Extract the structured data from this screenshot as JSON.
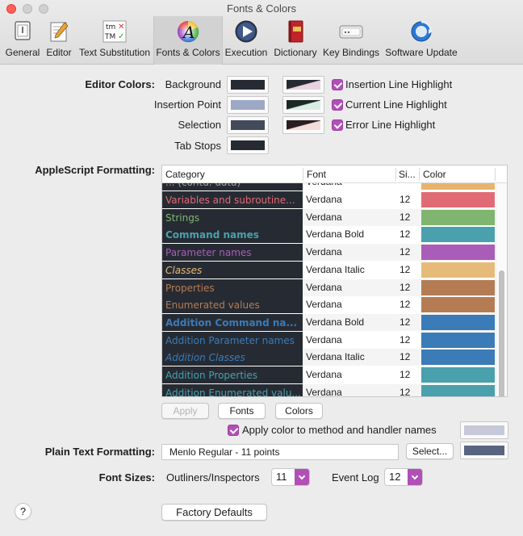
{
  "window": {
    "title": "Fonts & Colors"
  },
  "toolbar": [
    {
      "label": "General",
      "icon": "general-icon"
    },
    {
      "label": "Editor",
      "icon": "editor-icon"
    },
    {
      "label": "Text Substitution",
      "icon": "text-substitution-icon",
      "icon_text": "tm ✕\nTM ✓"
    },
    {
      "label": "Fonts & Colors",
      "icon": "fonts-colors-icon",
      "icon_text": "A"
    },
    {
      "label": "Execution",
      "icon": "execution-icon"
    },
    {
      "label": "Dictionary",
      "icon": "dictionary-icon"
    },
    {
      "label": "Key Bindings",
      "icon": "key-bindings-icon"
    },
    {
      "label": "Software Update",
      "icon": "software-update-icon"
    }
  ],
  "editor_colors": {
    "section_label": "Editor Colors:",
    "background_label": "Background",
    "insertion_point_label": "Insertion Point",
    "selection_label": "Selection",
    "tab_stops_label": "Tab Stops",
    "background_color": "#262b33",
    "insertion_point_color": "#9ca8c6",
    "selection_color": "#434b5a",
    "tab_stops_color": "#262b33",
    "highlights": [
      {
        "label": "Insertion Line Highlight",
        "checked": true,
        "colors": [
          "#262b33",
          "#e6d2e0"
        ]
      },
      {
        "label": "Current Line Highlight",
        "checked": true,
        "colors": [
          "#1c2a26",
          "#d8eee4"
        ]
      },
      {
        "label": "Error Line Highlight",
        "checked": true,
        "colors": [
          "#2a1e1e",
          "#f4dcd8"
        ]
      }
    ]
  },
  "applescript": {
    "section_label": "AppleScript Formatting:",
    "columns": [
      "Category",
      "Font",
      "Si...",
      "Color"
    ],
    "partial_top_row": {
      "category": "... (contd. data)",
      "font": "Verdana",
      "color": "#e7b36f"
    },
    "rows": [
      {
        "category": "Variables and subroutine...",
        "font": "Verdana",
        "size": "12",
        "color": "#e06b75",
        "text_color": "#e06b75",
        "style": "normal"
      },
      {
        "category": "Strings",
        "font": "Verdana",
        "size": "12",
        "color": "#7fb56f",
        "text_color": "#7fb56f",
        "style": "normal"
      },
      {
        "category": "Command names",
        "font": "Verdana Bold",
        "size": "12",
        "color": "#4aa0ac",
        "text_color": "#4aa0ac",
        "style": "bold"
      },
      {
        "category": "Parameter names",
        "font": "Verdana",
        "size": "12",
        "color": "#a95db9",
        "text_color": "#a95db9",
        "style": "normal"
      },
      {
        "category": "Classes",
        "font": "Verdana Italic",
        "size": "12",
        "color": "#e6bb7a",
        "text_color": "#e6bb7a",
        "style": "italic"
      },
      {
        "category": "Properties",
        "font": "Verdana",
        "size": "12",
        "color": "#b57c53",
        "text_color": "#b57c53",
        "style": "normal"
      },
      {
        "category": "Enumerated values",
        "font": "Verdana",
        "size": "12",
        "color": "#b57c53",
        "text_color": "#b57c53",
        "style": "normal"
      },
      {
        "category": "Addition Command na...",
        "font": "Verdana Bold",
        "size": "12",
        "color": "#3b7bb7",
        "text_color": "#3b7bb7",
        "style": "bold"
      },
      {
        "category": "Addition Parameter names",
        "font": "Verdana",
        "size": "12",
        "color": "#3b7bb7",
        "text_color": "#3b7bb7",
        "style": "normal"
      },
      {
        "category": "Addition Classes",
        "font": "Verdana Italic",
        "size": "12",
        "color": "#3b7bb7",
        "text_color": "#3b7bb7",
        "style": "italic"
      },
      {
        "category": "Addition Properties",
        "font": "Verdana",
        "size": "12",
        "color": "#48a1ad",
        "text_color": "#48a1ad",
        "style": "normal"
      },
      {
        "category": "Addition Enumerated valu...",
        "font": "Verdana",
        "size": "12",
        "color": "#48a1ad",
        "text_color": "#48a1ad",
        "style": "normal"
      }
    ],
    "buttons": {
      "apply": "Apply",
      "fonts": "Fonts",
      "colors": "Colors"
    },
    "apply_color_label": "Apply color to method and handler names",
    "apply_color_checked": true,
    "apply_color_swatch": "#c5c9d8"
  },
  "plain_text": {
    "section_label": "Plain Text Formatting:",
    "value": "Menlo Regular - 11 points",
    "select_button": "Select...",
    "swatch_color": "#596580"
  },
  "font_sizes": {
    "section_label": "Font Sizes:",
    "outliners_label": "Outliners/Inspectors",
    "outliners_value": "11",
    "event_log_label": "Event Log",
    "event_log_value": "12"
  },
  "help_label": "?",
  "factory_defaults_label": "Factory Defaults"
}
